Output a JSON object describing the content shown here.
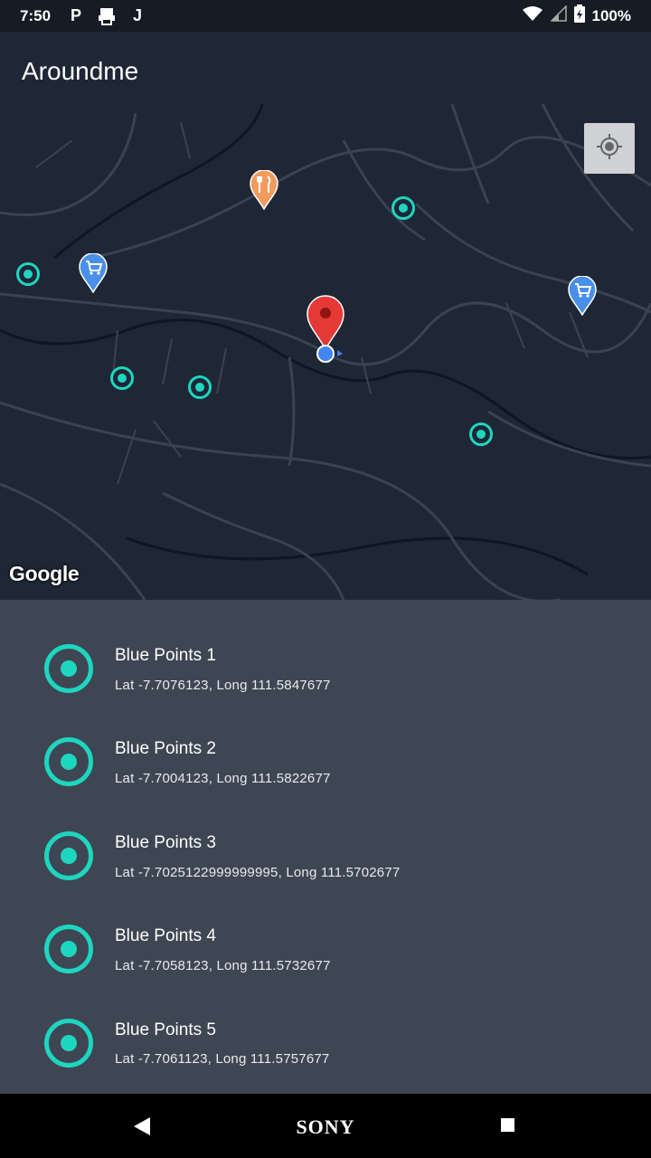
{
  "status_bar": {
    "time": "7:50",
    "notification_icons": [
      "p-icon",
      "printer-icon",
      "j-icon"
    ],
    "battery": "100%"
  },
  "app": {
    "title": "Aroundme"
  },
  "map": {
    "attribution": "Google",
    "locate_button_icon": "my-location-icon",
    "colors": {
      "background": "#1f2736",
      "roads": "#3a4352",
      "water": "#0e1626",
      "blue_point": "#1ed6c0",
      "user_pin": "#e53935",
      "shop_pin": "#4a8fe7",
      "restaurant_pin": "#f39b5e"
    }
  },
  "blue_points": [
    {
      "title": "Blue Points 1",
      "coords": "Lat -7.7076123, Long 111.5847677"
    },
    {
      "title": "Blue Points 2",
      "coords": "Lat -7.7004123, Long 111.5822677"
    },
    {
      "title": "Blue Points 3",
      "coords": "Lat -7.7025122999999995, Long 111.5702677"
    },
    {
      "title": "Blue Points 4",
      "coords": "Lat -7.7058123, Long 111.5732677"
    },
    {
      "title": "Blue Points 5",
      "coords": "Lat -7.7061123, Long 111.5757677"
    }
  ],
  "nav_bar": {
    "brand": "SONY",
    "back_icon": "back-triangle-icon",
    "recents_icon": "recents-square-icon"
  }
}
